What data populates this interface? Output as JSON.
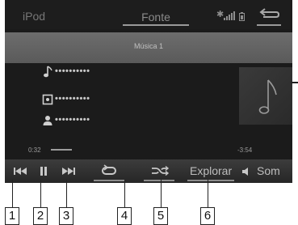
{
  "header": {
    "app_title": "iPod",
    "source_button": "Fonte",
    "status_icons": [
      "bluetooth-icon",
      "signal-icon",
      "battery-icon"
    ],
    "back_icon": "back-arrow-icon"
  },
  "source_band": {
    "label": "Música 1"
  },
  "track": {
    "song": "••••••••••",
    "album": "••••••••••",
    "artist": "••••••••••",
    "album_art_icon": "music-note-icon"
  },
  "playback": {
    "elapsed": "0:32",
    "remaining": "-3:54",
    "progress": 0.12
  },
  "controls": {
    "prev_icon": "skip-previous-icon",
    "pause_icon": "pause-icon",
    "next_icon": "skip-next-icon",
    "repeat_icon": "repeat-icon",
    "shuffle_icon": "shuffle-icon",
    "explorar_label": "Explorar",
    "som_label": "Som",
    "som_icon": "speaker-icon"
  },
  "callouts": [
    "1",
    "2",
    "3",
    "4",
    "5",
    "6"
  ],
  "colors": {
    "screen_bg": "#1b1b1b",
    "band_bg": "#656565",
    "text_light": "#c8c8c8",
    "text_dim": "#8a8a8a"
  }
}
